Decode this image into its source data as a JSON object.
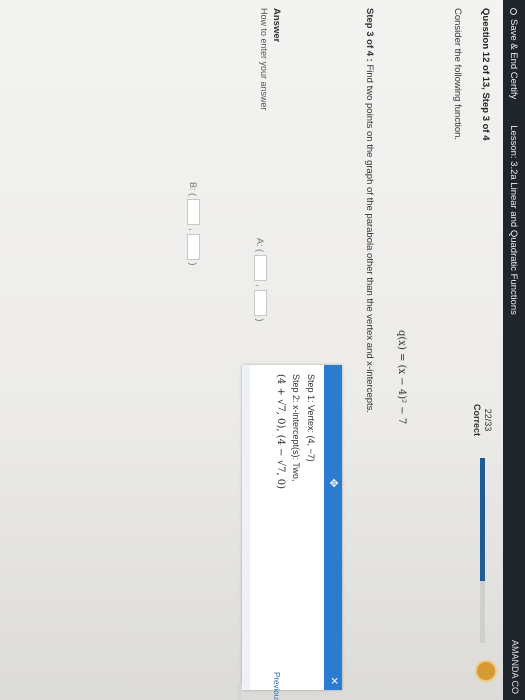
{
  "topbar": {
    "save_label": "Save & End Certify",
    "lesson_title": "Lesson: 3.2a Linear and Quadratic Functions",
    "user_name": "AMANDA CO"
  },
  "progress": {
    "count_label": "22/33",
    "status_label": "Correct",
    "fraction": 0.667,
    "fill_color": "#1f5a99"
  },
  "question": {
    "heading": "Question 12 of 13, Step 3 of 4",
    "prompt": "Consider the following function.",
    "function_text": "q(x) = (x − 4)² − 7",
    "step_label": "Step 3 of 4 :",
    "step_text": "Find two points on the graph of the parabola other than the vertex and x-intercepts."
  },
  "answer": {
    "heading": "Answer",
    "help_link": "How to enter your answer",
    "row_a_label": "A: (",
    "row_b_label": "B: (",
    "separator": ",",
    "close_paren": ")"
  },
  "hint_panel": {
    "move_icon": "move-icon",
    "close_icon": "close-icon",
    "step1": "Step 1: Vertex: (4, −7)",
    "step2": "Step 2: x-intercept(s): Two,",
    "step2_values": "(4 + √7, 0), (4 − √7, 0)",
    "header_color": "#2b7bd0"
  },
  "previous_step_link": "Previous S"
}
